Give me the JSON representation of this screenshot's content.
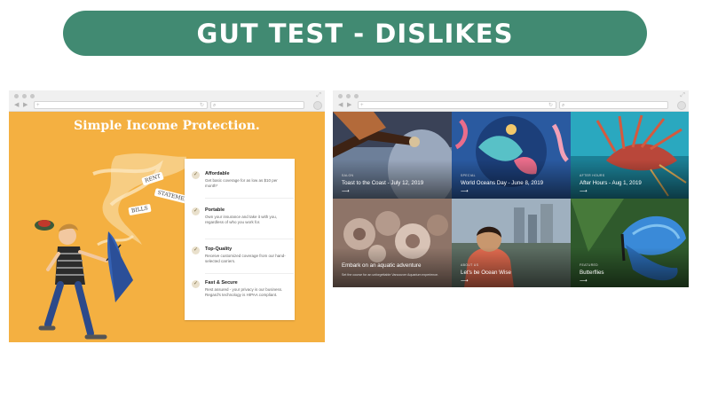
{
  "slide": {
    "title": "GUT TEST - DISLIKES"
  },
  "left_browser": {
    "headline": "Simple Income Protection.",
    "illustration_tags": [
      "RENT",
      "BILLS",
      "STATEMENTS"
    ],
    "features": [
      {
        "title": "Affordable",
        "desc": "Get basic coverage for as low as $10 per month*",
        "icon": "check-icon"
      },
      {
        "title": "Portable",
        "desc": "Own your insurance and take it with you, regardless of who you work for.",
        "icon": "check-icon"
      },
      {
        "title": "Top-Quality",
        "desc": "Receive customized coverage from our hand-selected carriers.",
        "icon": "check-icon"
      },
      {
        "title": "Fast & Secure",
        "desc": "Rest assured - your privacy is our business. Regard's technology is HIPAA compliant.",
        "icon": "check-icon"
      }
    ]
  },
  "right_browser": {
    "tiles": [
      {
        "category": "SALON",
        "caption": "Toast to the Coast - July 12, 2019",
        "sub": "",
        "arrow": "⟶",
        "color": "#7e8fa6"
      },
      {
        "category": "SPECIAL",
        "caption": "World Oceans Day - June 8, 2019",
        "sub": "",
        "arrow": "⟶",
        "color": "#1f4d86"
      },
      {
        "category": "AFTER HOURS",
        "caption": "After Hours - Aug 1, 2019",
        "sub": "",
        "arrow": "⟶",
        "color": "#1d5f70"
      },
      {
        "category": "",
        "caption": "Embark on an aquatic adventure",
        "sub": "Set the course for an unforgettable Vancouver Aquarium experience.",
        "arrow": "",
        "color": "#9c8479"
      },
      {
        "category": "ABOUT US",
        "caption": "Let's be Ocean Wise",
        "sub": "",
        "arrow": "⟶",
        "color": "#8a9aa8"
      },
      {
        "category": "FEATURED",
        "caption": "Butterflies",
        "sub": "",
        "arrow": "⟶",
        "color": "#3d6a36"
      }
    ]
  }
}
